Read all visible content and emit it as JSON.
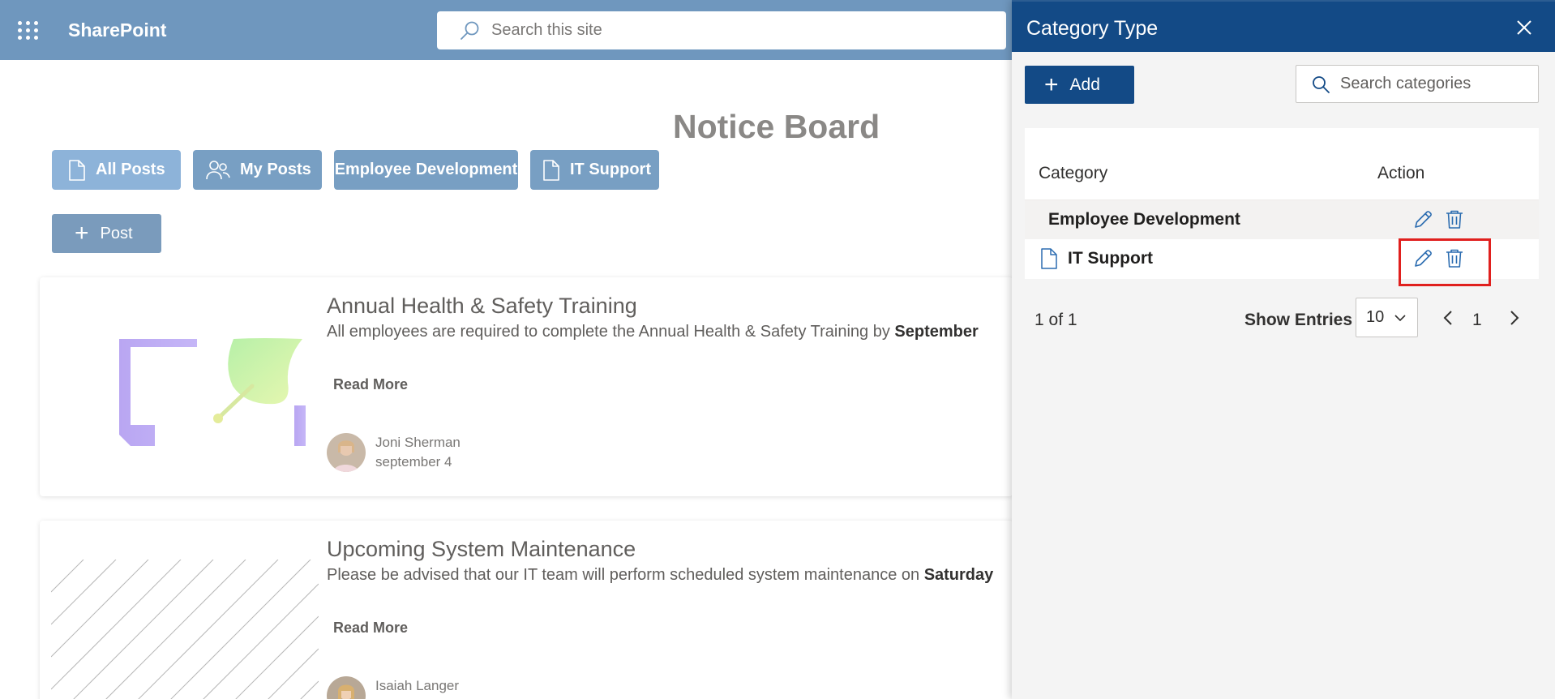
{
  "topbar": {
    "brand": "SharePoint",
    "search_placeholder": "Search this site"
  },
  "page": {
    "title": "Notice Board",
    "tabs": [
      {
        "label": "All Posts",
        "icon": "document-icon"
      },
      {
        "label": "My Posts",
        "icon": "people-icon"
      },
      {
        "label": "Employee Development",
        "icon": ""
      },
      {
        "label": "IT Support",
        "icon": "document-icon"
      }
    ],
    "post_button": "Post"
  },
  "posts": [
    {
      "title": "Annual Health & Safety Training",
      "text": "All employees are required to complete the Annual Health & Safety Training by ",
      "text_bold": "September",
      "read_more": "Read More",
      "author": "Joni Sherman",
      "date": "september 4"
    },
    {
      "title": "Upcoming System Maintenance",
      "text": "Please be advised that our IT team will perform scheduled system maintenance on ",
      "text_bold": "Saturday",
      "read_more": "Read More",
      "author": "Isaiah Langer",
      "date": ""
    }
  ],
  "panel": {
    "title": "Category Type",
    "add_label": "Add",
    "search_placeholder": "Search categories",
    "columns": {
      "category": "Category",
      "action": "Action"
    },
    "rows": [
      {
        "name": "Employee Development",
        "icon": ""
      },
      {
        "name": "IT Support",
        "icon": "document-icon"
      }
    ],
    "pager": {
      "count": "1 of 1",
      "show_entries_label": "Show Entries",
      "entries_value": "10",
      "current_page": "1"
    }
  },
  "colors": {
    "topbar": "#6f97be",
    "panel_header": "#134a86",
    "accent": "#134a86",
    "highlight": "#e0201e"
  }
}
